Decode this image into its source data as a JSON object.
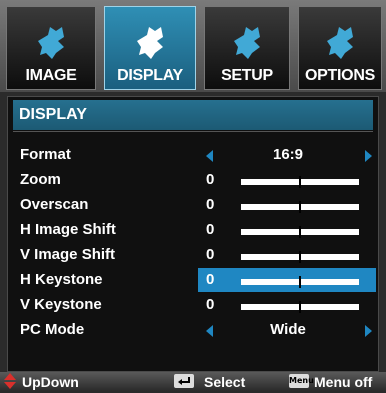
{
  "tabs": [
    {
      "label": "IMAGE",
      "icon": "puzzle-icon",
      "active": false
    },
    {
      "label": "DISPLAY",
      "icon": "puzzle-icon",
      "active": true
    },
    {
      "label": "SETUP",
      "icon": "puzzle-icon",
      "active": false
    },
    {
      "label": "OPTIONS",
      "icon": "puzzle-icon",
      "active": false
    }
  ],
  "section_title": "DISPLAY",
  "menu": [
    {
      "label": "Format",
      "value": "16:9",
      "type": "choice"
    },
    {
      "label": "Zoom",
      "value": "0",
      "type": "slider"
    },
    {
      "label": "Overscan",
      "value": "0",
      "type": "slider"
    },
    {
      "label": "H Image Shift",
      "value": "0",
      "type": "slider"
    },
    {
      "label": "V Image Shift",
      "value": "0",
      "type": "slider"
    },
    {
      "label": "H Keystone",
      "value": "0",
      "type": "slider",
      "selected": true
    },
    {
      "label": "V Keystone",
      "value": "0",
      "type": "slider"
    },
    {
      "label": "PC Mode",
      "value": "Wide",
      "type": "choice"
    }
  ],
  "footer": {
    "updown": "UpDown",
    "select": "Select",
    "menu_icon": "Menu",
    "menu_off": "Menu off"
  },
  "colors": {
    "accent": "#1f87c2",
    "tab_active": "#2a86ad",
    "updown_icon": "#d9302c"
  }
}
